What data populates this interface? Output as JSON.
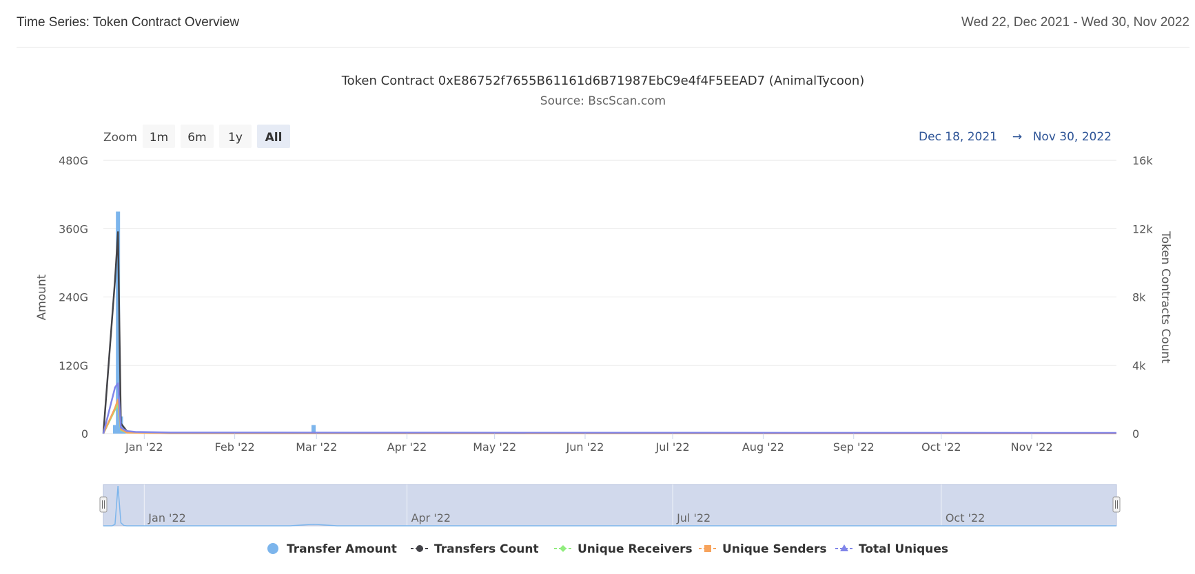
{
  "header": {
    "title": "Time Series: Token Contract Overview",
    "date_range": "Wed 22, Dec 2021 - Wed 30, Nov 2022"
  },
  "zoom": {
    "label": "Zoom",
    "buttons": [
      {
        "label": "1m",
        "state": "normal"
      },
      {
        "label": "6m",
        "state": "normal"
      },
      {
        "label": "1y",
        "state": "disabled"
      },
      {
        "label": "All",
        "state": "selected"
      }
    ],
    "range_from": "Dec 18, 2021",
    "range_arrow": "→",
    "range_to": "Nov 30, 2022"
  },
  "navigator": {
    "ticks": [
      "Jan '22",
      "Apr '22",
      "Jul '22",
      "Oct '22"
    ]
  },
  "colors": {
    "transfer_amount": "#7cb5ec",
    "transfers_count": "#434348",
    "unique_receivers": "#90ed7d",
    "unique_senders": "#f7a35c",
    "total_uniques": "#8085e9",
    "navigator_fill": "#d1d9ec"
  },
  "chart_data": {
    "type": "line",
    "title": "Token Contract 0xE86752f7655B61161d6B71987EbC9e4f4F5EEAD7 (AnimalTycoon)",
    "subtitle": "Source: BscScan.com",
    "x_range": [
      "2021-12-18",
      "2022-11-30"
    ],
    "x_ticks": [
      "Jan '22",
      "Feb '22",
      "Mar '22",
      "Apr '22",
      "May '22",
      "Jun '22",
      "Jul '22",
      "Aug '22",
      "Sep '22",
      "Oct '22",
      "Nov '22"
    ],
    "y_left": {
      "label": "Amount",
      "ticks": [
        "0",
        "120G",
        "240G",
        "360G",
        "480G"
      ],
      "range": [
        0,
        480
      ]
    },
    "y_right": {
      "label": "Token Contracts Count",
      "ticks": [
        "0",
        "4k",
        "8k",
        "12k",
        "16k"
      ],
      "range": [
        0,
        16000
      ]
    },
    "grid": true,
    "legend_position": "bottom",
    "series": [
      {
        "name": "Transfer Amount",
        "kind": "column",
        "axis": "left",
        "unit": "G",
        "points": [
          [
            "2021-12-22",
            15
          ],
          [
            "2021-12-23",
            390
          ],
          [
            "2021-12-24",
            30
          ],
          [
            "2021-12-25",
            3
          ],
          [
            "2022-02-28",
            15
          ]
        ]
      },
      {
        "name": "Transfers Count",
        "kind": "line",
        "axis": "right",
        "points": [
          [
            "2021-12-18",
            0
          ],
          [
            "2021-12-22",
            9000
          ],
          [
            "2021-12-23",
            11800
          ],
          [
            "2021-12-24",
            600
          ],
          [
            "2021-12-26",
            150
          ],
          [
            "2021-12-29",
            60
          ],
          [
            "2022-01-10",
            30
          ],
          [
            "2022-11-30",
            20
          ]
        ]
      },
      {
        "name": "Unique Receivers",
        "kind": "line",
        "axis": "right",
        "points": [
          [
            "2021-12-18",
            0
          ],
          [
            "2021-12-22",
            1400
          ],
          [
            "2021-12-23",
            1700
          ],
          [
            "2021-12-24",
            200
          ],
          [
            "2021-12-26",
            60
          ],
          [
            "2022-01-10",
            20
          ],
          [
            "2022-11-30",
            10
          ]
        ]
      },
      {
        "name": "Unique Senders",
        "kind": "line",
        "axis": "right",
        "points": [
          [
            "2021-12-18",
            0
          ],
          [
            "2021-12-22",
            1500
          ],
          [
            "2021-12-23",
            2000
          ],
          [
            "2021-12-24",
            250
          ],
          [
            "2021-12-26",
            60
          ],
          [
            "2022-01-10",
            20
          ],
          [
            "2022-11-30",
            10
          ]
        ]
      },
      {
        "name": "Total Uniques",
        "kind": "line",
        "axis": "right",
        "points": [
          [
            "2021-12-18",
            0
          ],
          [
            "2021-12-22",
            2700
          ],
          [
            "2021-12-23",
            2950
          ],
          [
            "2021-12-24",
            350
          ],
          [
            "2021-12-26",
            150
          ],
          [
            "2021-12-29",
            100
          ],
          [
            "2022-01-10",
            60
          ],
          [
            "2022-11-30",
            40
          ]
        ]
      }
    ]
  }
}
